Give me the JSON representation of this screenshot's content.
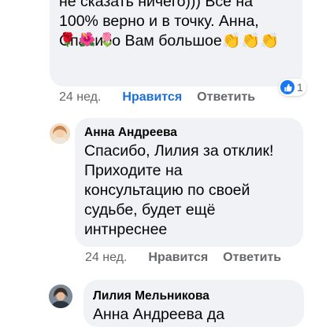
{
  "comment1": {
    "text": "не сказать ничего))) Все на\n100% верно и в точку. Анна,\nСпасибо Вам большое👏👏👏",
    "emojis": [
      "🌹",
      "🌺",
      "🌷"
    ],
    "time": "24 нед.",
    "like_label": "Нравится",
    "reply_label": "Ответить",
    "reaction_count": "1",
    "accent_color": "#1d6fd8"
  },
  "comment2": {
    "author": "Анна Андреева",
    "text": "Спасибо, Лилия за отклик!\nПриходите на\nконсультацию по своей\nсудьбе, будет ещё\nинтнреснее",
    "time": "24 нед.",
    "like_label": "Нравится",
    "reply_label": "Ответить"
  },
  "comment3": {
    "author": "Лилия Мельникова",
    "text": "Анна Андреева да"
  }
}
